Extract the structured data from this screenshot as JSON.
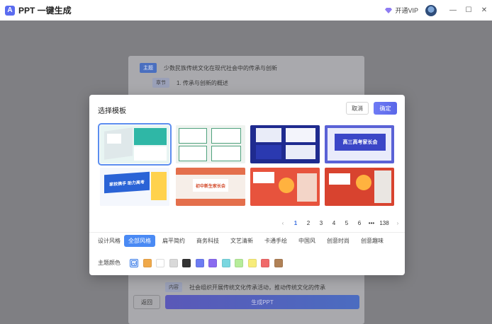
{
  "app": {
    "title": "PPT 一键生成",
    "logo_char": "A"
  },
  "titlebar": {
    "vip_label": "开通VIP",
    "min": "—",
    "max": "☐",
    "close": "✕"
  },
  "editor": {
    "rows": [
      {
        "tag": "主题",
        "text": "少数民族传统文化在现代社会中的传承与创新"
      },
      {
        "tag": "章节",
        "text": "1. 传承与创新的概述"
      },
      {
        "tag": "内容",
        "text": "社会组织开展传统文化传承活动，推动传统文化的传承"
      }
    ],
    "back_label": "返回",
    "generate_label": "生成PPT"
  },
  "modal": {
    "title": "选择模板",
    "cancel_label": "取消",
    "confirm_label": "确定",
    "templates": [
      {
        "title": "",
        "selected": true
      },
      {
        "title": "",
        "selected": false
      },
      {
        "title": "",
        "selected": false
      },
      {
        "title": "高三高考家长会",
        "selected": false
      },
      {
        "title": "家校携手 助力高考",
        "selected": false
      },
      {
        "title": "初中新生家长会",
        "selected": false
      },
      {
        "title": "",
        "selected": false
      },
      {
        "title": "",
        "selected": false
      }
    ],
    "pagination": {
      "prev": "‹",
      "pages": [
        "1",
        "2",
        "3",
        "4",
        "5",
        "6"
      ],
      "active_page": "1",
      "ellipsis": "•••",
      "last": "138",
      "next": "›"
    },
    "style_filter": {
      "label": "设计风格",
      "options": [
        "全部风格",
        "扁平简约",
        "商务科技",
        "文艺清新",
        "卡通手绘",
        "中国风",
        "创意时尚",
        "创意趣味"
      ],
      "active": "全部风格"
    },
    "color_filter": {
      "label": "主题颜色",
      "swatches": [
        "#f0a94a",
        "#ffffff",
        "#d9d9d9",
        "#333333",
        "#6d7cf2",
        "#8a6bf0",
        "#7ad7e0",
        "#b6ec9a",
        "#f7ec7a",
        "#f06a6a",
        "#b08156"
      ]
    }
  }
}
